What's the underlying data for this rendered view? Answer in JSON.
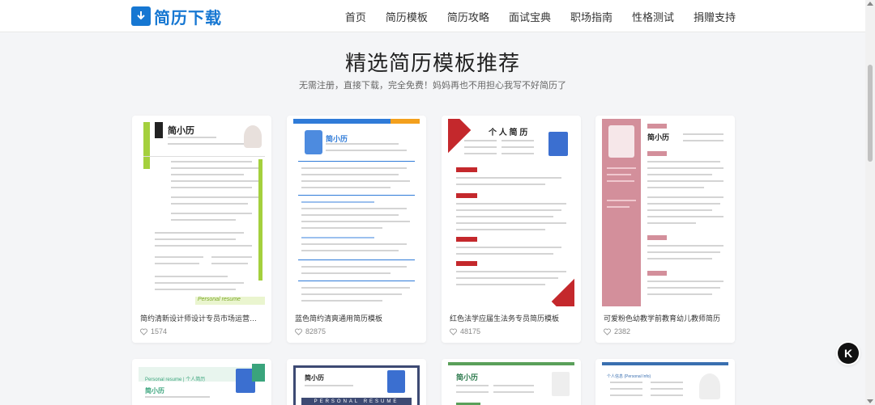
{
  "brand": {
    "name": "简历下载",
    "color": "#1677d2"
  },
  "nav": {
    "items": [
      "首页",
      "简历模板",
      "简历攻略",
      "面试宝典",
      "职场指南",
      "性格测试",
      "捐赠支持"
    ]
  },
  "hero": {
    "title": "精选简历模板推荐",
    "subtitle": "无需注册，直接下载，完全免费！妈妈再也不用担心我写不好简历了"
  },
  "cards": [
    {
      "title": "简约清新设计师设计专员市场运营新媒体运...",
      "likes": "1574",
      "thumb_name": "简小历",
      "thumb_accent": "#a4d03d"
    },
    {
      "title": "蓝色简约清爽通用简历模板",
      "likes": "82875",
      "thumb_name": "简小历",
      "thumb_accent": "#2f7bd8"
    },
    {
      "title": "红色法学应届生法务专员简历模板",
      "likes": "48175",
      "thumb_name": "个 人 简 历",
      "thumb_accent": "#c4282c"
    },
    {
      "title": "可爱粉色幼教学前教育幼儿教师简历",
      "likes": "2382",
      "thumb_name": "简小历",
      "thumb_accent": "#d38f9b"
    }
  ],
  "row2": [
    {
      "thumb_name": "简小历",
      "thumb_label": "Personal resume | 个人简历",
      "thumb_accent": "#3aa47c"
    },
    {
      "thumb_name": "简小历",
      "thumb_label": "PERSONAL RESUME",
      "thumb_accent": "#3d4a73"
    },
    {
      "thumb_name": "简小历",
      "thumb_label": "",
      "thumb_accent": "#5aa05a"
    },
    {
      "thumb_name": "",
      "thumb_label": "个人信息 (Personal Info)",
      "thumb_accent": "#3a6fb0"
    }
  ],
  "float_button": {
    "label": "K"
  }
}
